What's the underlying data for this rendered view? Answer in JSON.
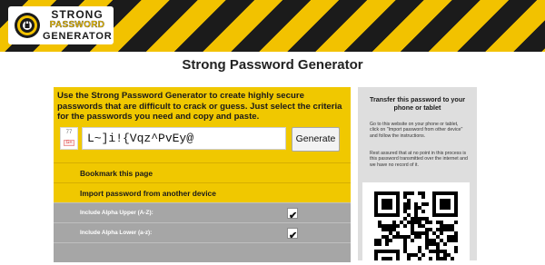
{
  "header": {
    "logo_line1": "STRONG",
    "logo_line2": "PASSWORD",
    "logo_line3": "GENERATOR",
    "stripe_colors": [
      "#1b1b1b",
      "#f2c200"
    ]
  },
  "page": {
    "title": "Strong Password Generator"
  },
  "main": {
    "intro": "Use the Strong Password Generator to create highly secure passwords that are difficult to crack or guess. Just select the criteria for the passwords you need and copy and paste.",
    "seed_number": "77",
    "seed_icon": "G+",
    "password_value": "L~]i!{Vqz^PvEy@",
    "generate_label": "Generate",
    "bookmark_label": "Bookmark this page",
    "import_label": "Import password from another device",
    "options": [
      {
        "label": "Include Alpha Upper (A-Z):",
        "checked": true
      },
      {
        "label": "Include Alpha Lower (a-z):",
        "checked": true
      },
      {
        "label": "",
        "checked": false
      }
    ],
    "panel_color": "#f0c800"
  },
  "side": {
    "title": "Transfer this password to your phone or tablet",
    "instructions": "Go to this website on your phone or tablet, click on \"Import password from other device\" and follow the instructions.",
    "note": "Rest assured that at no point in this process is this password transmitted over the internet and we have no record of it."
  }
}
